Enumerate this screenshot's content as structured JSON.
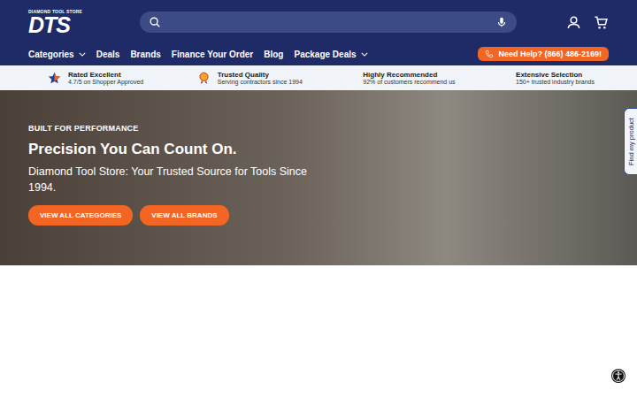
{
  "logo": {
    "tagline": "DIAMOND TOOL STORE",
    "mark": "DTS"
  },
  "nav": [
    {
      "label": "Categories",
      "dropdown": true
    },
    {
      "label": "Deals",
      "dropdown": false
    },
    {
      "label": "Brands",
      "dropdown": false
    },
    {
      "label": "Finance Your Order",
      "dropdown": false
    },
    {
      "label": "Blog",
      "dropdown": false
    },
    {
      "label": "Package Deals",
      "dropdown": true
    }
  ],
  "help_button": "Need Help? (866) 486-2169!",
  "trust": [
    {
      "title": "Rated Excellent",
      "subtitle": "4.7/5 on Shopper Approved"
    },
    {
      "title": "Trusted Quality",
      "subtitle": "Serving contractors since 1994"
    },
    {
      "title": "Highly Recommended",
      "subtitle": "92% of customers recommend us"
    },
    {
      "title": "Extensive Selection",
      "subtitle": "150+ trusted industry brands"
    }
  ],
  "hero": {
    "eyebrow": "BUILT FOR PERFORMANCE",
    "title": "Precision You Can Count On.",
    "subtitle": "Diamond Tool Store: Your Trusted Source for Tools Since 1994.",
    "buttons": [
      "VIEW ALL CATEGORIES",
      "VIEW ALL BRANDS"
    ]
  },
  "side_tab": "Find my product"
}
